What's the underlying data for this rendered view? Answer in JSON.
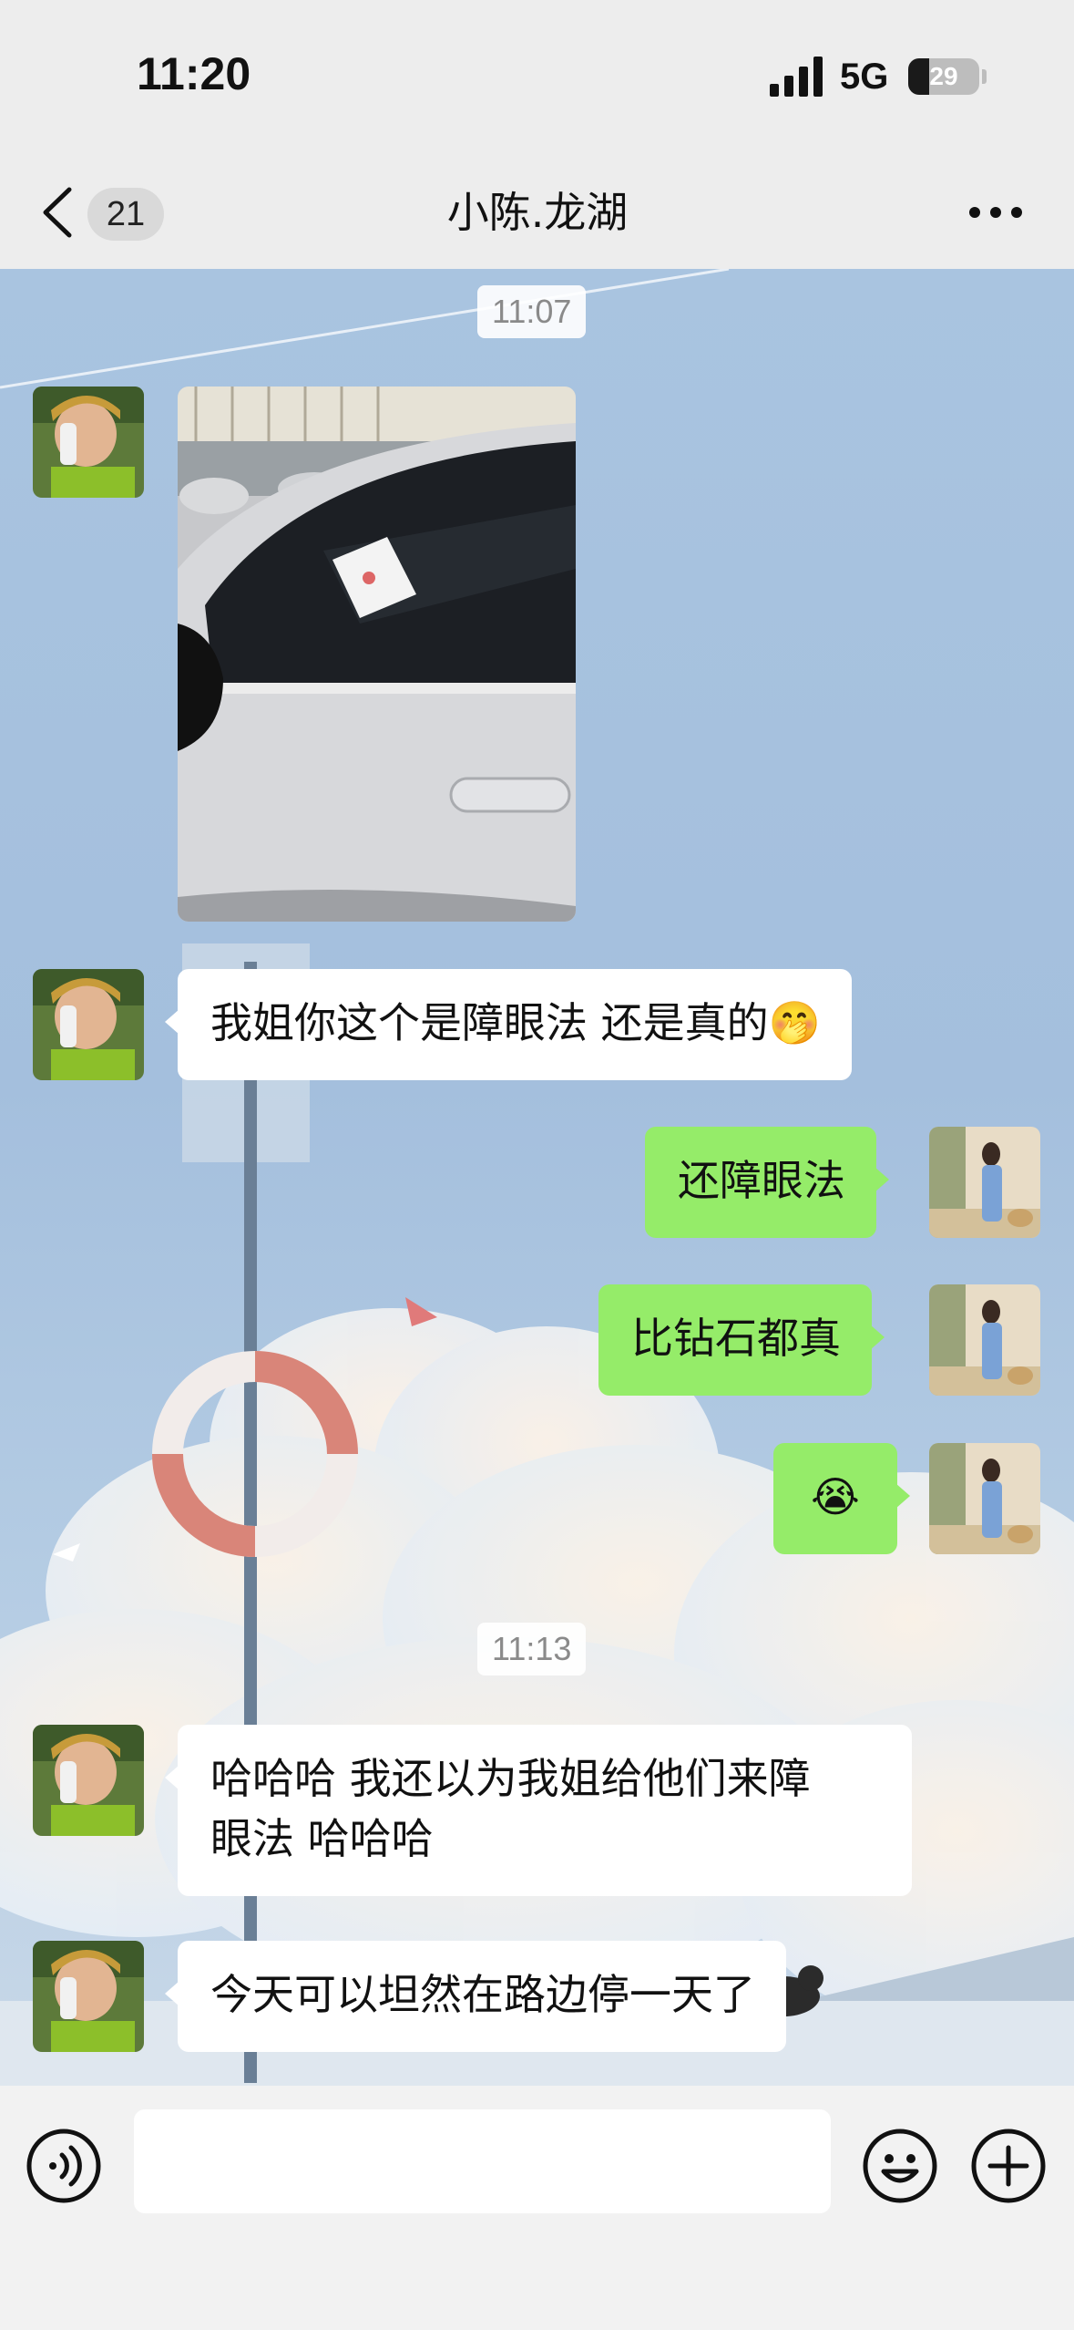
{
  "status_bar": {
    "time": "11:20",
    "network": "5G",
    "battery_level": "29",
    "battery_percent": 29,
    "signal_icon": "cellular-signal-icon"
  },
  "nav": {
    "back_icon": "chevron-left-icon",
    "unread_count": "21",
    "title": "小陈.龙湖",
    "more_icon": "more-dots-icon"
  },
  "chat": {
    "timestamp_1": "11:07",
    "photo": "photo of a white car with a parking ticket on the window",
    "msg_1": "我姐你这个是障眼法  还是真的",
    "msg_1_emoji": "🤭",
    "msg_2": "还障眼法",
    "msg_3": "比钻石都真",
    "msg_4_emoji": "😭",
    "timestamp_2": "11:13",
    "msg_5_line1": "哈哈哈  我还以为我姐给他们来障",
    "msg_5_line2": "眼法  哈哈哈",
    "msg_6": "今天可以坦然在路边停一天了"
  },
  "input_bar": {
    "voice_icon": "voice-input-icon",
    "input_value": "",
    "emoji_icon": "emoji-smile-icon",
    "plus_icon": "plus-circle-icon"
  },
  "colors": {
    "bubble_in": "#ffffff",
    "bubble_out": "#95ec69",
    "header_bg": "#ededed",
    "chat_bg": "#a9c4e0"
  }
}
